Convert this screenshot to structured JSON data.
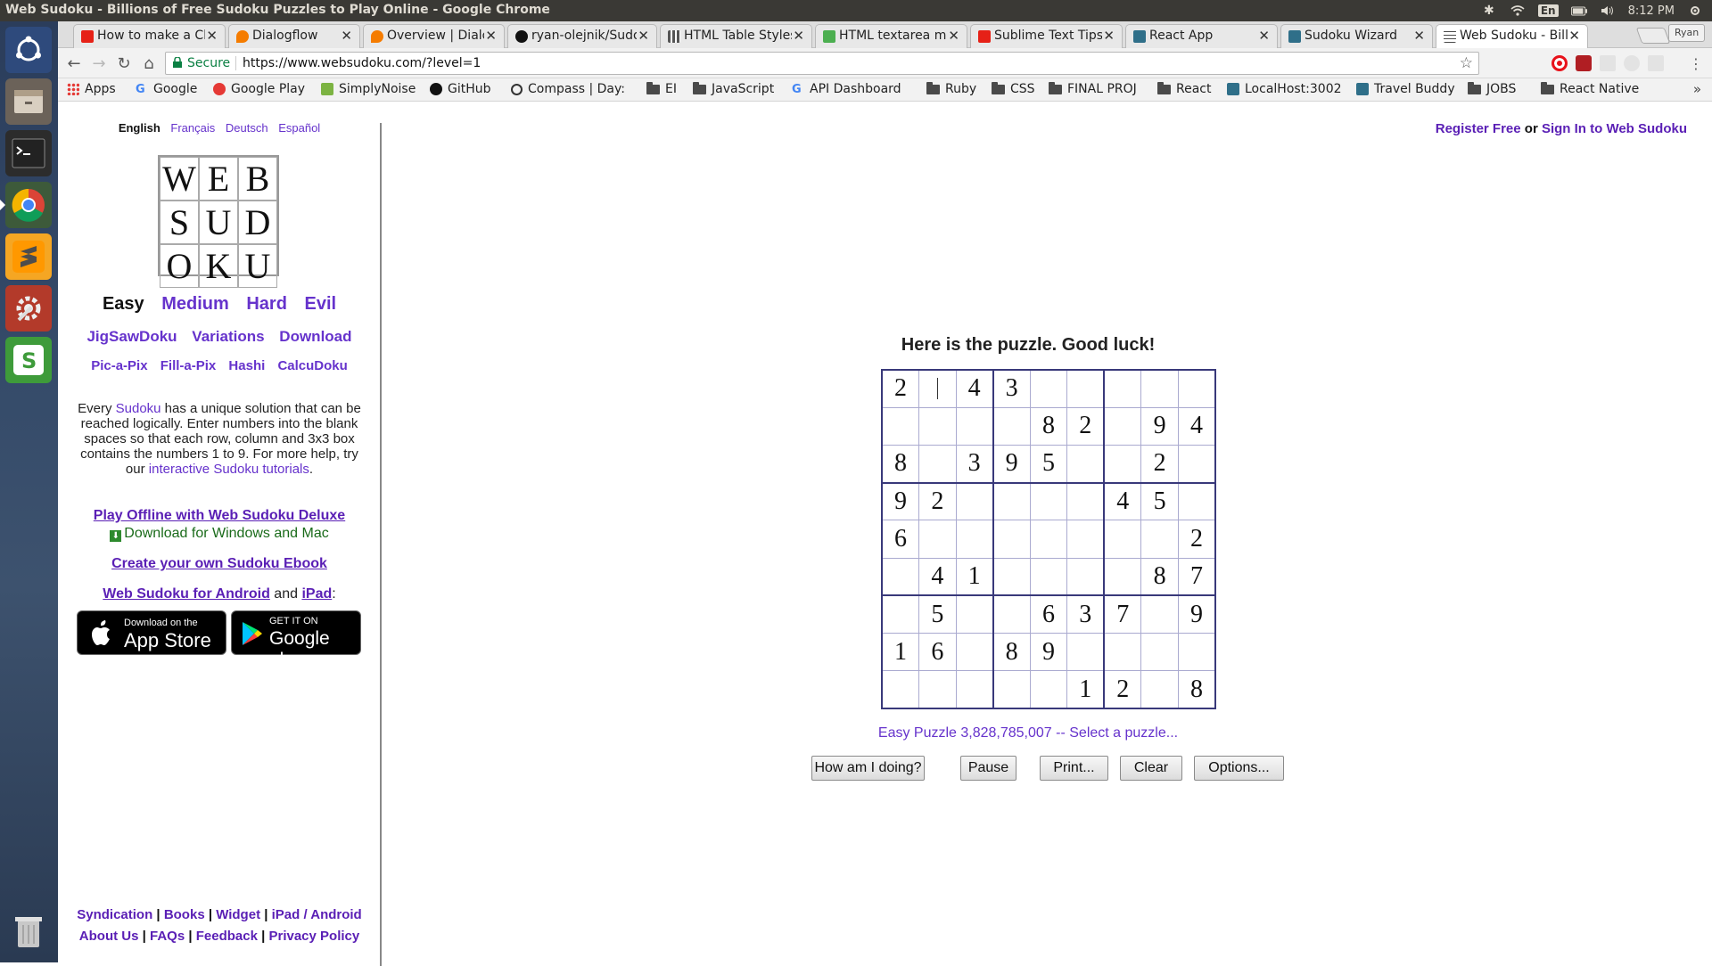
{
  "os": {
    "window_title": "Web Sudoku - Billions of Free Sudoku Puzzles to Play Online - Google Chrome",
    "lang": "En",
    "time": "8:12 PM"
  },
  "tabs": [
    {
      "label": "How to make a Chat",
      "active": false,
      "color": "#e62117"
    },
    {
      "label": "Dialogflow",
      "active": false,
      "color": "#f57c00"
    },
    {
      "label": "Overview | Dialogflow",
      "active": false,
      "color": "#f57c00"
    },
    {
      "label": "ryan-olejnik/Sudoku",
      "active": false,
      "color": "#111111"
    },
    {
      "label": "HTML Table Styles",
      "active": false,
      "color": "#555555"
    },
    {
      "label": "HTML textarea maxlength",
      "active": false,
      "color": "#4caf50"
    },
    {
      "label": "Sublime Text Tips",
      "active": false,
      "color": "#e62117"
    },
    {
      "label": "React App",
      "active": false,
      "color": "#2f6f89"
    },
    {
      "label": "Sudoku Wizard",
      "active": false,
      "color": "#2f6f89"
    },
    {
      "label": "Web Sudoku - Billions",
      "active": true,
      "color": "#4a4a4a"
    }
  ],
  "profile": "Ryan",
  "address": {
    "secure_label": "Secure",
    "url": "https://www.websudoku.com/?level=1"
  },
  "bookmarks": [
    {
      "label": "Apps",
      "kind": "apps"
    },
    {
      "label": "Google",
      "kind": "google"
    },
    {
      "label": "Google Play",
      "kind": "play"
    },
    {
      "label": "SimplyNoise",
      "kind": "noise"
    },
    {
      "label": "GitHub",
      "kind": "github"
    },
    {
      "label": "Compass | Day:",
      "kind": "compass"
    },
    {
      "label": "EI",
      "kind": "folder"
    },
    {
      "label": "JavaScript",
      "kind": "folder"
    },
    {
      "label": "API Dashboard",
      "kind": "google"
    },
    {
      "label": "Ruby",
      "kind": "folder"
    },
    {
      "label": "CSS",
      "kind": "folder"
    },
    {
      "label": "FINAL PROJ",
      "kind": "folder"
    },
    {
      "label": "React",
      "kind": "folder"
    },
    {
      "label": "LocalHost:3002",
      "kind": "react"
    },
    {
      "label": "Travel Buddy",
      "kind": "react"
    },
    {
      "label": "JOBS",
      "kind": "folder"
    },
    {
      "label": "React Native",
      "kind": "folder"
    }
  ],
  "sidebar": {
    "languages": [
      "English",
      "Français",
      "Deutsch",
      "Español"
    ],
    "logo_letters": [
      "W",
      "E",
      "B",
      "S",
      "U",
      "D",
      "O",
      "K",
      "U"
    ],
    "levels": [
      "Easy",
      "Medium",
      "Hard",
      "Evil"
    ],
    "more_links": [
      "JigSawDoku",
      "Variations",
      "Download"
    ],
    "games": [
      "Pic-a-Pix",
      "Fill-a-Pix",
      "Hashi",
      "CalcuDoku"
    ],
    "intro": {
      "p1": "Every ",
      "sudoku_link": "Sudoku",
      "p2": " has a unique solution that can be reached logically. Enter numbers into the blank spaces so that each row, column and 3x3 box contains the numbers 1 to 9. For more help, try our ",
      "tutorial_link": "interactive Sudoku tutorials",
      "p3": "."
    },
    "deluxe_link": "Play Offline with Web Sudoku Deluxe",
    "deluxe_download": "Download for Windows and Mac",
    "ebook_link": "Create your own Sudoku Ebook",
    "android_link": "Web Sudoku for Android",
    "and": "and",
    "ipad_link": "iPad",
    "colon": ":",
    "app_store": {
      "small": "Download on the",
      "big": "App Store"
    },
    "google_play": {
      "small": "GET IT ON",
      "big": "Google play"
    },
    "footer_row1": [
      "Syndication",
      "Books",
      "Widget",
      "iPad / Android"
    ],
    "footer_row2": [
      "About Us",
      "FAQs",
      "Feedback",
      "Privacy Policy"
    ]
  },
  "account": {
    "register": "Register Free",
    "or": "or",
    "signin": "Sign In to Web Sudoku"
  },
  "puzzle": {
    "heading": "Here is the puzzle. Good luck!",
    "grid": [
      [
        "2",
        "",
        "4",
        "3",
        "",
        "",
        "",
        "",
        ""
      ],
      [
        "",
        "",
        "",
        "",
        "8",
        "2",
        "",
        "9",
        "4"
      ],
      [
        "8",
        "",
        "3",
        "9",
        "5",
        "",
        "",
        "2",
        ""
      ],
      [
        "9",
        "2",
        "",
        "",
        "",
        "",
        "4",
        "5",
        ""
      ],
      [
        "6",
        "",
        "",
        "",
        "",
        "",
        "",
        "",
        "2"
      ],
      [
        "",
        "4",
        "1",
        "",
        "",
        "",
        "",
        "8",
        "7"
      ],
      [
        "",
        "5",
        "",
        "",
        "6",
        "3",
        "7",
        "",
        "9"
      ],
      [
        "1",
        "6",
        "",
        "8",
        "9",
        "",
        "",
        "",
        ""
      ],
      [
        "",
        "",
        "",
        "",
        "",
        "1",
        "2",
        "",
        "8"
      ]
    ],
    "info": "Easy Puzzle 3,828,785,007 -- Select a puzzle...",
    "buttons": {
      "check": "How am I doing?",
      "pause": "Pause",
      "print": "Print...",
      "clear": "Clear",
      "options": "Options..."
    }
  }
}
